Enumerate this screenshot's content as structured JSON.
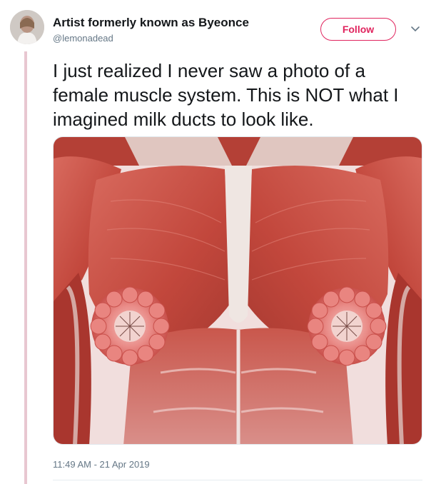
{
  "tweet": {
    "author_name": "Artist formerly known as Byeonce",
    "author_handle": "@lemonadead",
    "follow_label": "Follow",
    "text": "I just realized I never saw a photo of a female muscle system. This is NOT what I imagined milk ducts to look like.",
    "timestamp": "11:49 AM - 21 Apr 2019"
  },
  "icons": {
    "menu": "chevron-down-icon",
    "avatar": "avatar"
  },
  "colors": {
    "follow_accent": "#e0245e",
    "thread_line": "#e8c7d1",
    "text": "#14171a",
    "secondary_text": "#657786"
  },
  "media": {
    "content": "anatomical-illustration"
  }
}
